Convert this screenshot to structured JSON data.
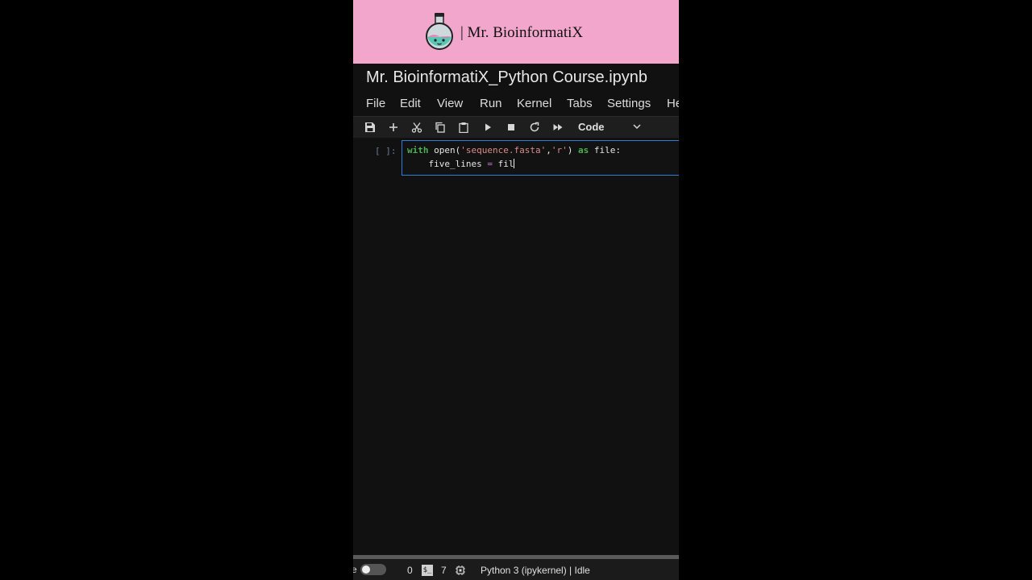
{
  "banner": {
    "logo": "flask-icon",
    "brand_text": "| Mr. BioinformatiX",
    "background": "#f3a6cc"
  },
  "notebook": {
    "title": "Mr. BioinformatiX_Python Course.ipynb"
  },
  "menu": {
    "items": [
      "File",
      "Edit",
      "View",
      "Run",
      "Kernel",
      "Tabs",
      "Settings",
      "He"
    ]
  },
  "toolbar": {
    "icons": [
      "save-icon",
      "add-cell-icon",
      "cut-icon",
      "copy-icon",
      "paste-icon",
      "run-icon",
      "stop-icon",
      "restart-icon",
      "fast-forward-icon"
    ],
    "cell_type": "Code"
  },
  "cell": {
    "prompt": "[ ]:",
    "line1": {
      "kw_with": "with",
      "fn_open": " open(",
      "str_file": "'sequence.fasta'",
      "comma": ",",
      "str_mode": "'r'",
      "close": ")",
      "kw_as": " as",
      "var_file": " file:"
    },
    "line2": {
      "indent_var": "    five_lines",
      "op_eq": " = ",
      "partial": "fil"
    },
    "border_color": "#2f7dd7"
  },
  "statusbar": {
    "edge_char": "e",
    "toggle_state": "off",
    "count_a": "0",
    "terminal_icon_label": "$_",
    "count_b": "7",
    "kernel_status": "Python 3 (ipykernel) | Idle"
  }
}
